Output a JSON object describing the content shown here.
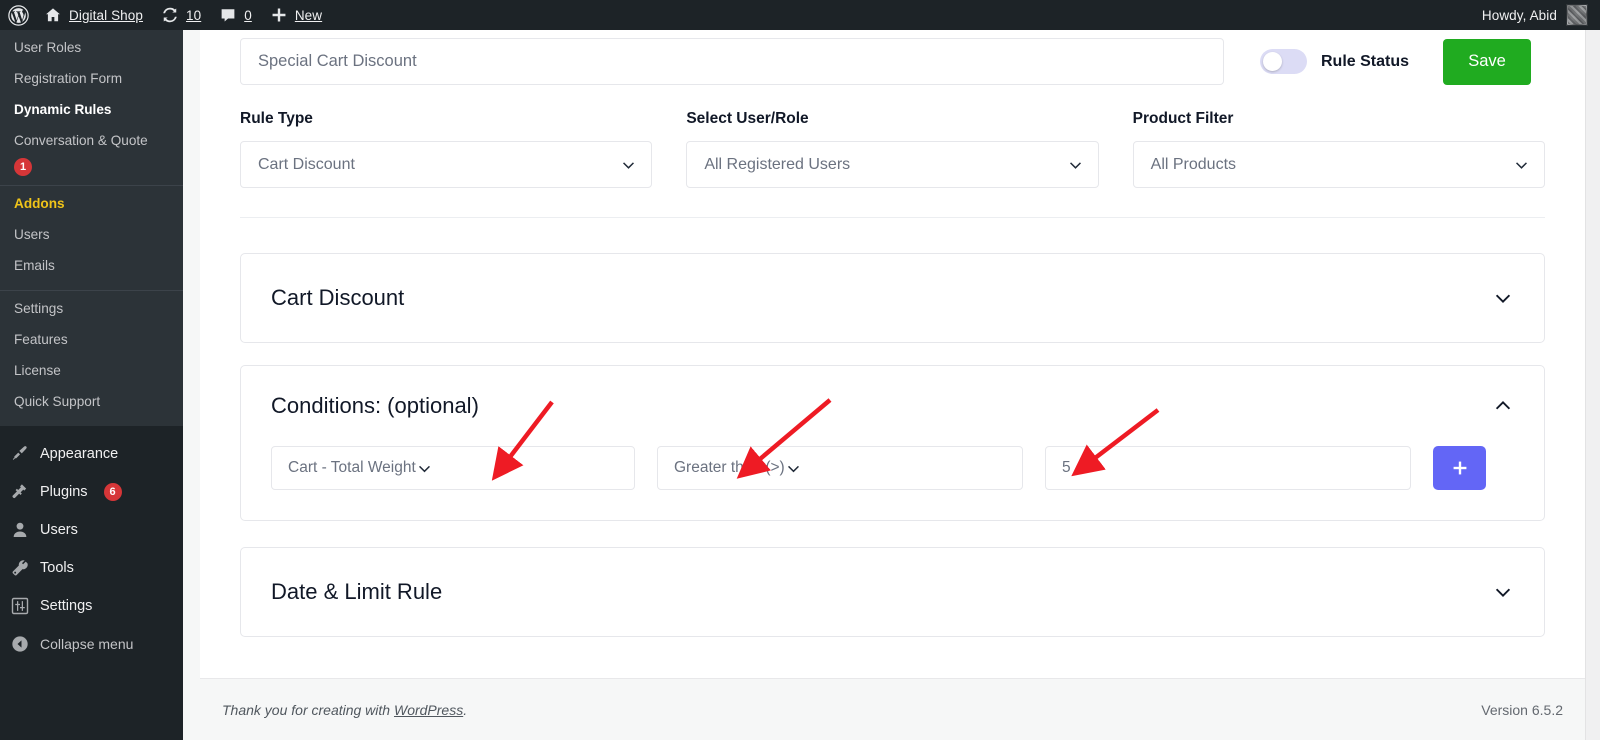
{
  "adminbar": {
    "site_name": "Digital Shop",
    "updates_count": "10",
    "comments_count": "0",
    "new_label": "New",
    "howdy": "Howdy, Abid",
    "icons": {
      "wordpress": "wordpress-logo-icon",
      "home": "home-icon",
      "updates": "updates-icon",
      "comments": "comment-bubble-icon",
      "new": "plus-icon",
      "avatar": "user-avatar"
    }
  },
  "sidebar": {
    "submenu": [
      {
        "label": "User Roles",
        "current": false
      },
      {
        "label": "Registration Form",
        "current": false
      },
      {
        "label": "Dynamic Rules",
        "current": true
      },
      {
        "label": "Conversation & Quote",
        "current": false,
        "badge": "1"
      }
    ],
    "submenu2": [
      {
        "label": "Addons",
        "highlight": true
      },
      {
        "label": "Users"
      },
      {
        "label": "Emails"
      }
    ],
    "submenu3": [
      {
        "label": "Settings"
      },
      {
        "label": "Features"
      },
      {
        "label": "License"
      },
      {
        "label": "Quick Support"
      }
    ],
    "topmenu": [
      {
        "label": "Appearance",
        "icon": "paintbrush-icon"
      },
      {
        "label": "Plugins",
        "icon": "plug-icon",
        "badge": "6"
      },
      {
        "label": "Users",
        "icon": "user-icon"
      },
      {
        "label": "Tools",
        "icon": "wrench-icon"
      },
      {
        "label": "Settings",
        "icon": "sliders-icon"
      },
      {
        "label": "Collapse menu",
        "icon": "collapse-arrow-icon"
      }
    ]
  },
  "header": {
    "title_placeholder": "Special Cart Discount",
    "title_value": "",
    "rule_status_label": "Rule Status",
    "rule_status_on": false,
    "save_label": "Save"
  },
  "filters": [
    {
      "label": "Rule Type",
      "value": "Cart Discount"
    },
    {
      "label": "Select User/Role",
      "value": "All Registered Users"
    },
    {
      "label": "Product Filter",
      "value": "All Products"
    }
  ],
  "panels": {
    "cart_discount": {
      "title": "Cart Discount",
      "expanded": false,
      "chevron": "chevron-down-icon"
    },
    "conditions": {
      "title": "Conditions: (optional)",
      "expanded": true,
      "chevron": "chevron-up-icon",
      "field": "Cart - Total Weight",
      "operator": "Greater than (>)",
      "value": "5",
      "value_placeholder": "",
      "add_label": "+"
    },
    "date_limit": {
      "title": "Date & Limit Rule",
      "expanded": false,
      "chevron": "chevron-down-icon"
    }
  },
  "footer": {
    "thanks_prefix": "Thank you for creating with ",
    "thanks_link": "WordPress",
    "thanks_suffix": ".",
    "version": "Version 6.5.2"
  },
  "colors": {
    "admin_dark": "#1d2327",
    "submenu_bg": "#2c3338",
    "save_green": "#20ab20",
    "add_purple": "#6366f6",
    "addons_yellow": "#f0c419",
    "badge_red": "#d63638",
    "arrow_red": "#ee1b24",
    "toggle_track": "#dcdcf5"
  }
}
